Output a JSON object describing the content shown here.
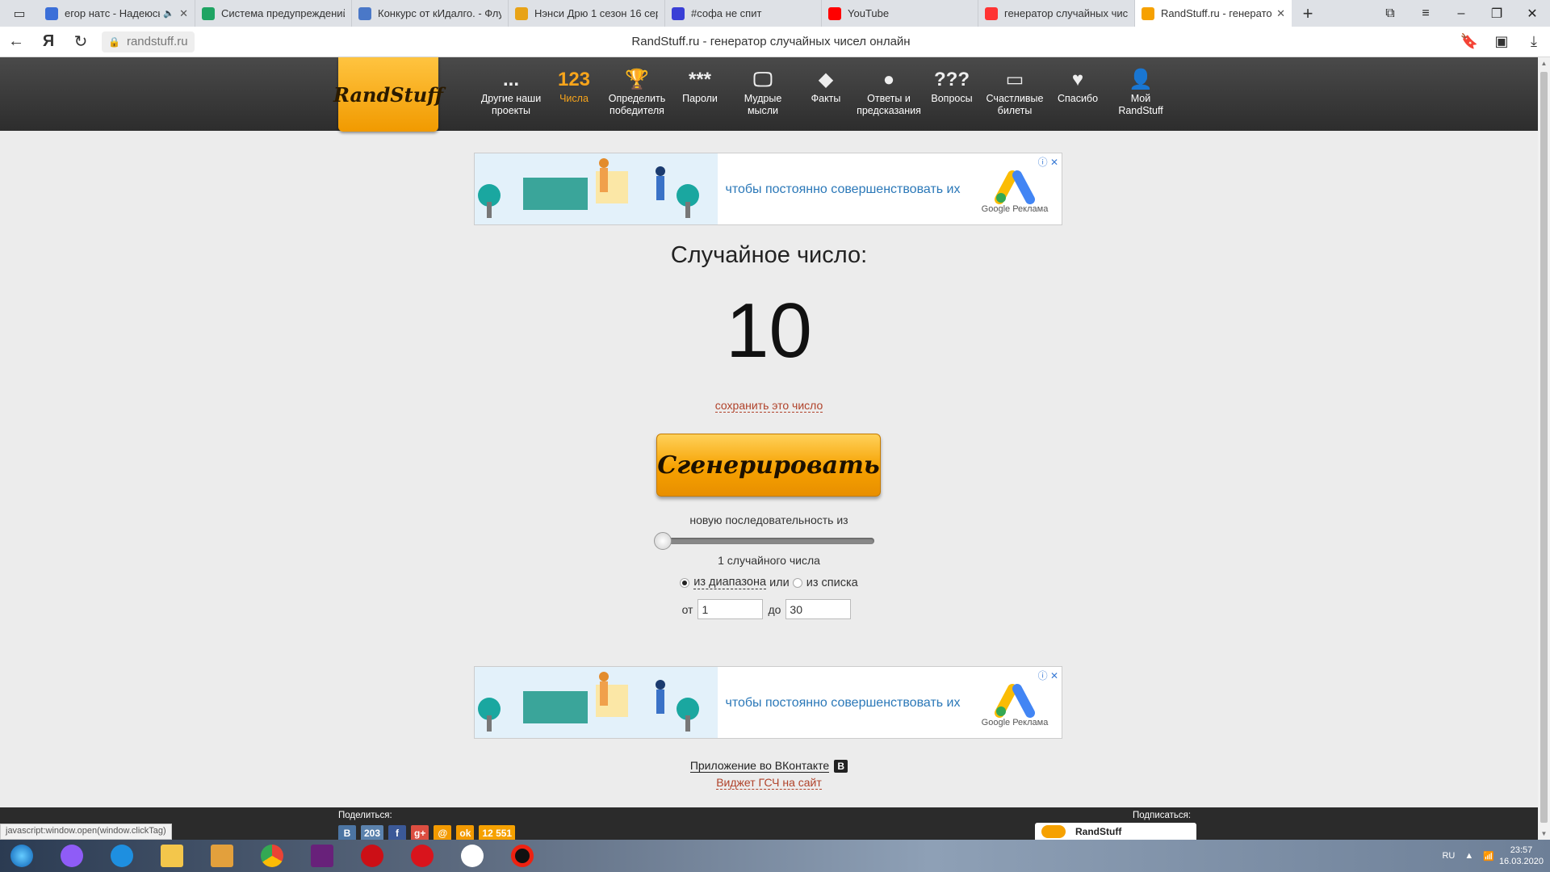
{
  "browser": {
    "tabs": [
      {
        "title": "егор натс - Надеюсь",
        "fav_color": "#3b6fd8",
        "fav_icon": "video-icon",
        "muted": true
      },
      {
        "title": "Система предупреждений",
        "fav_color": "#1fa463",
        "fav_icon": "sheets-icon"
      },
      {
        "title": "Конкурс от кИдалго. - Флу",
        "fav_color": "#4a78c8",
        "fav_icon": "vk-icon"
      },
      {
        "title": "Нэнси Дрю 1 сезон 16 сер",
        "fav_color": "#e8a317",
        "fav_icon": "film-icon"
      },
      {
        "title": "#софа не спит",
        "fav_color": "#3a3fd6",
        "fav_icon": "vk-icon"
      },
      {
        "title": "YouTube",
        "fav_color": "#ff0000",
        "fav_icon": "youtube-icon"
      },
      {
        "title": "генератор случайных чис",
        "fav_color": "#ff3333",
        "fav_icon": "yandex-icon"
      },
      {
        "title": "RandStuff.ru - генерато",
        "fav_color": "#f6a100",
        "fav_icon": "randstuff-icon",
        "active": true
      }
    ],
    "url": "randstuff.ru",
    "page_title": "RandStuff.ru - генератор случайных чисел онлайн",
    "status_text": "javascript:window.open(window.clickTag)"
  },
  "header": {
    "logo": "RandStuff",
    "nav": [
      {
        "icon_text": "...",
        "icon": "dots-icon",
        "label": "Другие наши проекты"
      },
      {
        "icon_text": "123",
        "icon": "numbers-icon",
        "label": "Числа",
        "active": true
      },
      {
        "icon_text": "🏆",
        "icon": "trophy-icon",
        "label": "Определить победителя"
      },
      {
        "icon_text": "***",
        "icon": "password-icon",
        "label": "Пароли"
      },
      {
        "icon_text": "🖵",
        "icon": "quotes-icon",
        "label": "Мудрые мысли"
      },
      {
        "icon_text": "◆",
        "icon": "facts-icon",
        "label": "Факты"
      },
      {
        "icon_text": "●",
        "icon": "eightball-icon",
        "label": "Ответы и предсказания"
      },
      {
        "icon_text": "???",
        "icon": "questions-icon",
        "label": "Вопросы"
      },
      {
        "icon_text": "▭",
        "icon": "ticket-icon",
        "label": "Счастливые билеты"
      },
      {
        "icon_text": "♥",
        "icon": "heart-icon",
        "label": "Спасибо"
      },
      {
        "icon_text": "👤",
        "icon": "user-icon",
        "label": "Мой RandStuff"
      }
    ]
  },
  "ad": {
    "text": "чтобы постоянно совершенствовать их",
    "brand": "Google Реклама"
  },
  "generator": {
    "result_label": "Случайное число:",
    "result_value": "10",
    "save_link": "сохранить это число",
    "generate_button": "Сгенерировать",
    "sequence_label": "новую последовательность из",
    "slider_value": 1,
    "count_label": "1 случайного числа",
    "mode_range": "из диапазона",
    "mode_or": "или",
    "mode_list": "из списка",
    "from_label": "от",
    "from_value": "1",
    "to_label": "до",
    "to_value": "30"
  },
  "links": {
    "vk_app": "Приложение во ВКонтакте",
    "widget": "Виджет ГСЧ на сайт"
  },
  "footer": {
    "share_label": "Поделиться:",
    "share_buttons": [
      {
        "name": "vk",
        "text": "В",
        "color": "#4c75a3"
      },
      {
        "name": "vk-count",
        "text": "203",
        "color": "#5b82ad"
      },
      {
        "name": "facebook",
        "text": "f",
        "color": "#3b5998"
      },
      {
        "name": "google-plus",
        "text": "g+",
        "color": "#dc4e41"
      },
      {
        "name": "mail",
        "text": "@",
        "color": "#f39a00"
      },
      {
        "name": "odnoklassniki",
        "text": "ok",
        "color": "#f39a00"
      },
      {
        "name": "ok-count",
        "text": "12 551",
        "color": "#f6a100"
      }
    ],
    "subscribe_label": "Подписаться:",
    "subscribe_widget": "RandStuff"
  },
  "taskbar": {
    "lang": "RU",
    "time": "23:57",
    "date": "16.03.2020"
  }
}
